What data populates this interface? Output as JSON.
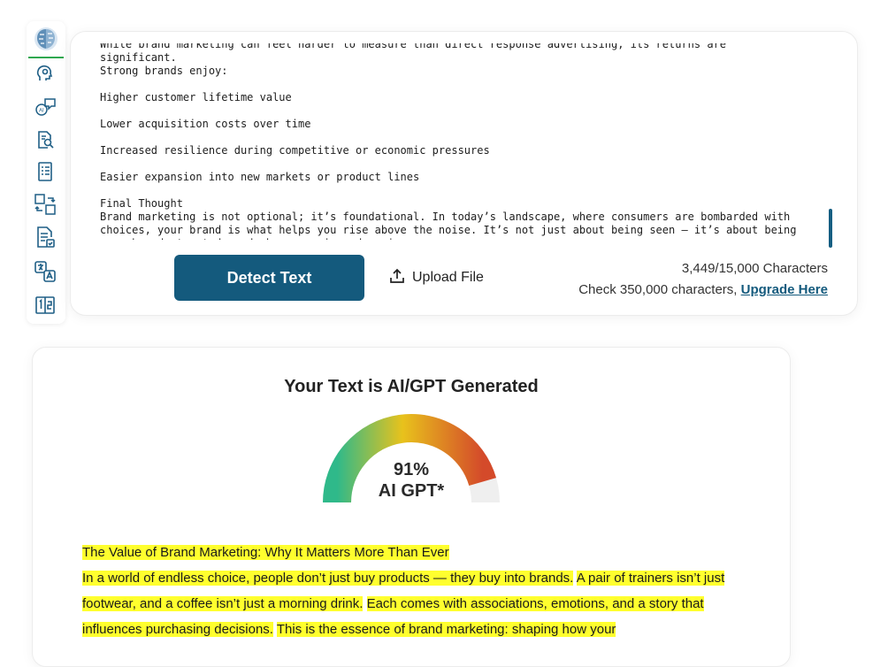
{
  "sidebar": {
    "icons": [
      "brain-logo-icon",
      "ai-head-icon",
      "ai-chat-icon",
      "document-search-icon",
      "document-list-icon",
      "image-convert-icon",
      "document-check-icon",
      "translate-icon",
      "number-grid-icon"
    ]
  },
  "editor": {
    "lines": [
      "While brand marketing can feel harder to measure than direct response advertising, its returns are significant.",
      "Strong brands enjoy:",
      "",
      "Higher customer lifetime value",
      "",
      "Lower acquisition costs over time",
      "",
      "Increased resilience during competitive or economic pressures",
      "",
      "Easier expansion into new markets or product lines",
      "",
      "Final Thought",
      "Brand marketing is not optional; it’s foundational. In today’s landscape, where consumers are bombarded with",
      "choices, your brand is what helps you rise above the noise. It’s not just about being seen — it’s about being",
      "remembered, trusted, and chosen again and again."
    ],
    "detect_label": "Detect Text",
    "upload_label": "Upload File",
    "char_count": "3,449/15,000 Characters",
    "check_text": "Check 350,000 characters, ",
    "upgrade_label": "Upgrade Here"
  },
  "result": {
    "title": "Your Text is AI/GPT Generated",
    "percent": "91%",
    "percent_value": 91,
    "gauge_label": "AI GPT*",
    "colors": {
      "green": "#2fb98a",
      "yellow": "#e8c21c",
      "red": "#d44a2a",
      "track": "#efefef",
      "highlight": "#ffff2e"
    },
    "segments": [
      "The Value of Brand Marketing: Why It Matters More Than Ever",
      "In a world of endless choice, people don’t just buy products — they buy into brands.",
      "A pair of trainers isn’t just footwear, and a coffee isn’t just a morning drink.",
      "Each comes with associations, emotions, and a story that influences purchasing decisions.",
      "This is the essence of brand marketing: shaping how your"
    ]
  }
}
